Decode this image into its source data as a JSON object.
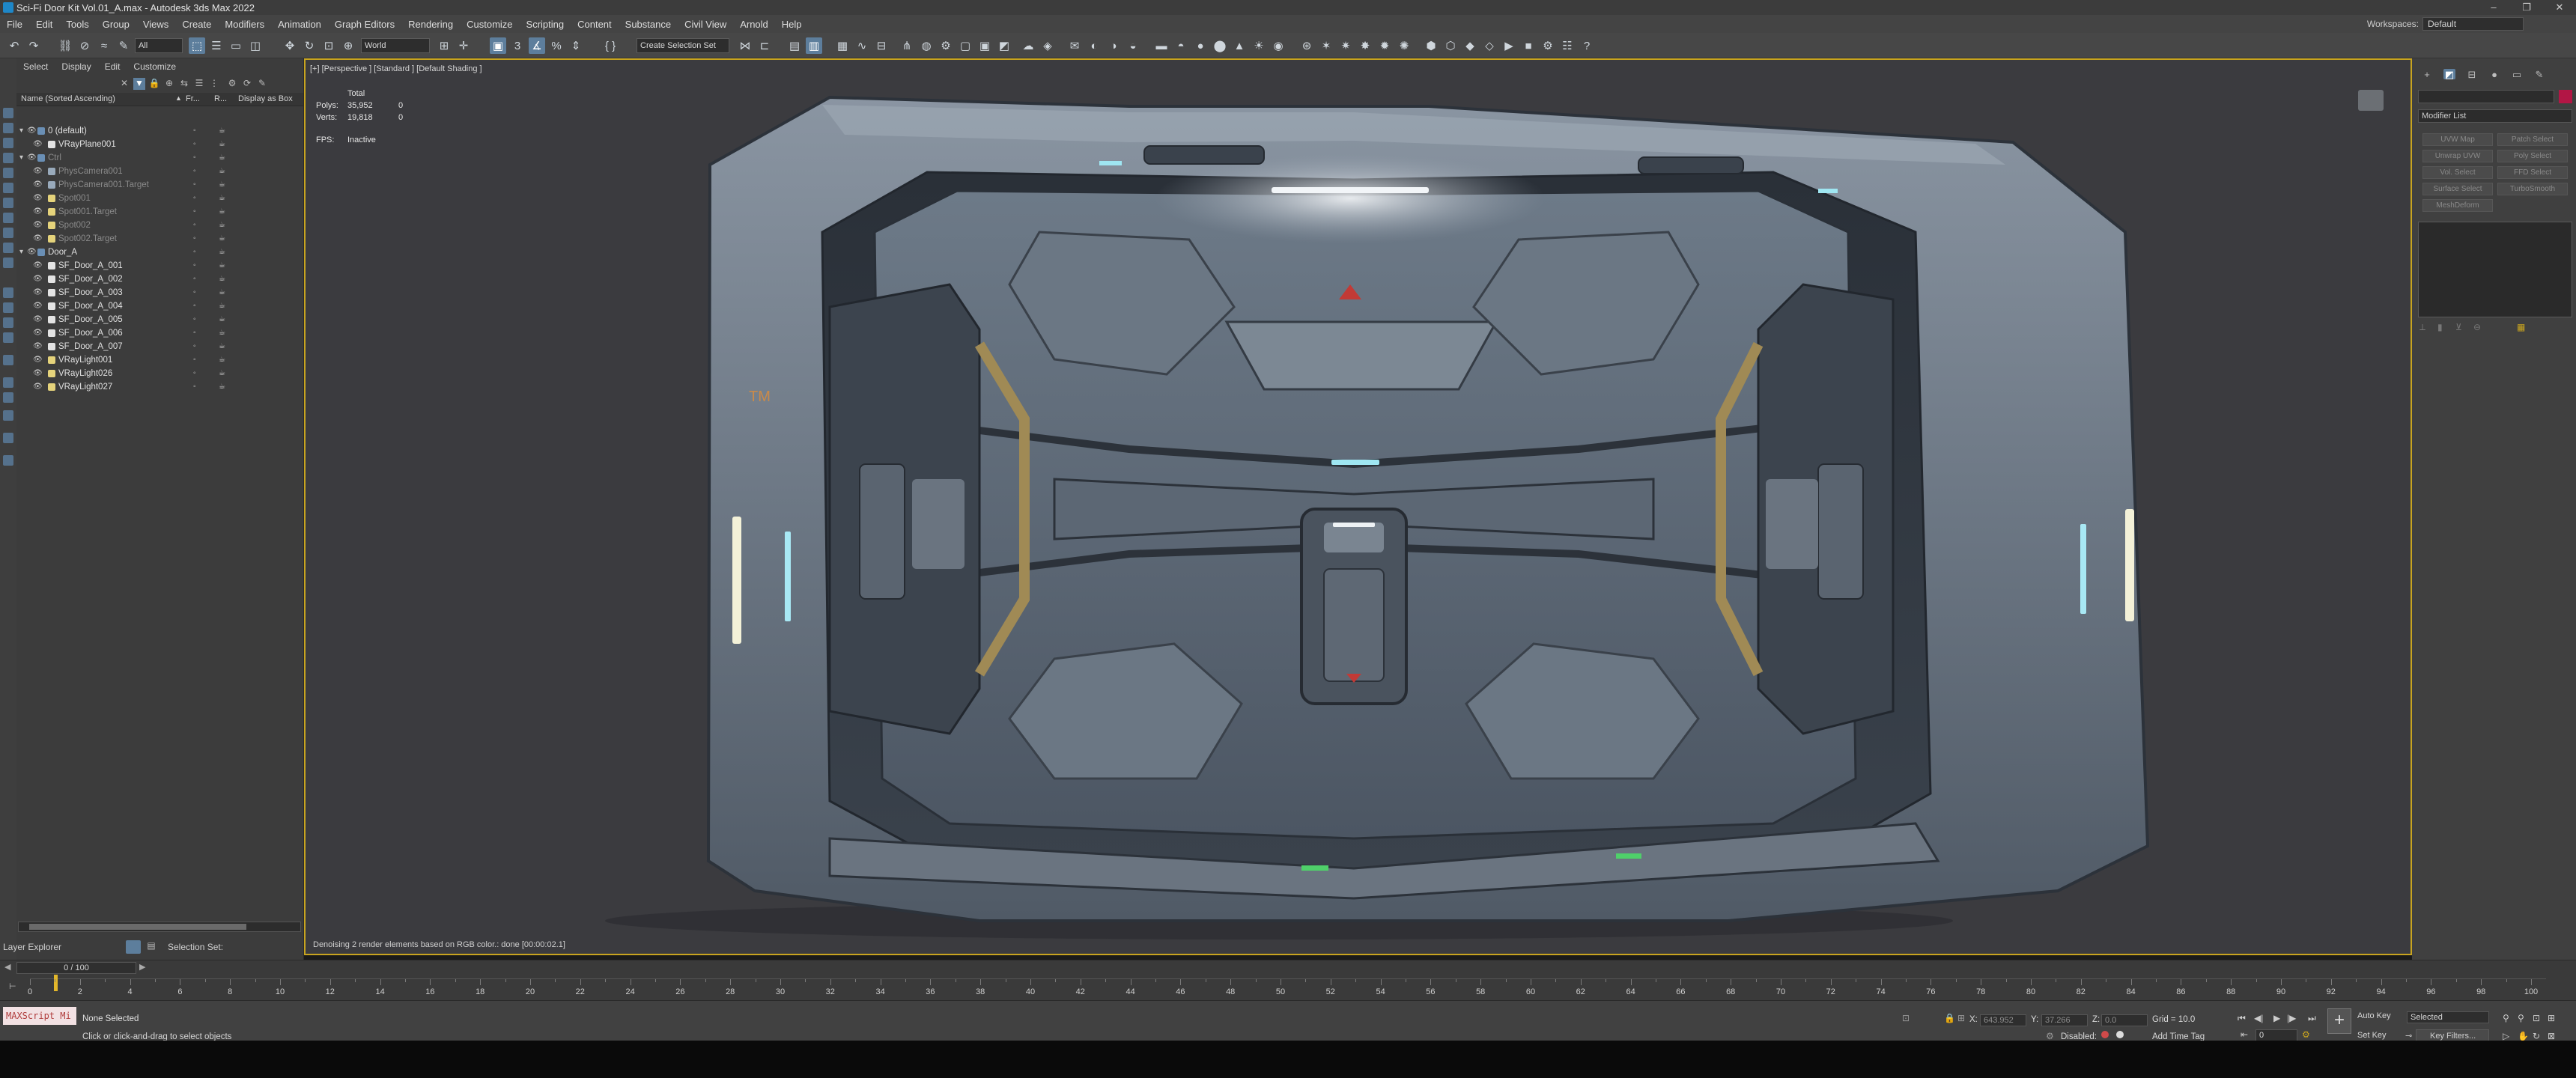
{
  "window": {
    "title": "Sci-Fi Door Kit Vol.01_A.max - Autodesk 3ds Max 2022",
    "controls": [
      "–",
      "❐",
      "✕"
    ]
  },
  "menu": {
    "items": [
      "File",
      "Edit",
      "Tools",
      "Group",
      "Views",
      "Create",
      "Modifiers",
      "Animation",
      "Graph Editors",
      "Rendering",
      "Customize",
      "Scripting",
      "Content",
      "Substance",
      "Civil View",
      "Arnold",
      "Help"
    ],
    "workspace_label": "Workspaces:",
    "workspace_value": "Default"
  },
  "toolbar": {
    "selection_filter": "All",
    "ref_coord": "World",
    "named_selection": "Create Selection Set"
  },
  "scene_explorer": {
    "tabs": [
      "Select",
      "Display",
      "Edit",
      "Customize"
    ],
    "columns": [
      "Name (Sorted Ascending)",
      "Fr...",
      "R...",
      "Display as Box"
    ],
    "rows": [
      {
        "name": "0 (default)",
        "indent": 1,
        "type": "layer",
        "dim": false
      },
      {
        "name": "VRayPlane001",
        "indent": 2,
        "type": "geo",
        "dim": false
      },
      {
        "name": "Ctrl",
        "indent": 1,
        "type": "layer",
        "dim": true
      },
      {
        "name": "PhysCamera001",
        "indent": 2,
        "type": "cam",
        "dim": true
      },
      {
        "name": "PhysCamera001.Target",
        "indent": 2,
        "type": "cam",
        "dim": true
      },
      {
        "name": "Spot001",
        "indent": 2,
        "type": "light",
        "dim": true
      },
      {
        "name": "Spot001.Target",
        "indent": 2,
        "type": "light",
        "dim": true
      },
      {
        "name": "Spot002",
        "indent": 2,
        "type": "light",
        "dim": true
      },
      {
        "name": "Spot002.Target",
        "indent": 2,
        "type": "light",
        "dim": true
      },
      {
        "name": "Door_A",
        "indent": 1,
        "type": "layer",
        "dim": false
      },
      {
        "name": "SF_Door_A_001",
        "indent": 2,
        "type": "geo",
        "dim": false
      },
      {
        "name": "SF_Door_A_002",
        "indent": 2,
        "type": "geo",
        "dim": false
      },
      {
        "name": "SF_Door_A_003",
        "indent": 2,
        "type": "geo",
        "dim": false
      },
      {
        "name": "SF_Door_A_004",
        "indent": 2,
        "type": "geo",
        "dim": false
      },
      {
        "name": "SF_Door_A_005",
        "indent": 2,
        "type": "geo",
        "dim": false
      },
      {
        "name": "SF_Door_A_006",
        "indent": 2,
        "type": "geo",
        "dim": false
      },
      {
        "name": "SF_Door_A_007",
        "indent": 2,
        "type": "geo",
        "dim": false
      },
      {
        "name": "VRayLight001",
        "indent": 2,
        "type": "light",
        "dim": false
      },
      {
        "name": "VRayLight026",
        "indent": 2,
        "type": "light",
        "dim": false
      },
      {
        "name": "VRayLight027",
        "indent": 2,
        "type": "light",
        "dim": false
      }
    ],
    "bottom_label": "Layer Explorer",
    "selection_set_label": "Selection Set:"
  },
  "viewport": {
    "label": "[+] [Perspective ] [Standard ] [Default Shading ]",
    "stats_title": "Total",
    "polys_label": "Polys:",
    "polys_value": "35,952",
    "polys_sel": "0",
    "verts_label": "Verts:",
    "verts_value": "19,818",
    "verts_sel": "0",
    "fps_label": "FPS:",
    "fps_value": "Inactive",
    "render_status": "Denoising 2 render elements based on RGB color.: done [00:00:02.1]",
    "door_labels": {
      "tm": "TM"
    }
  },
  "command_panel": {
    "modifier_list": "Modifier List",
    "buttons": [
      "UVW Map",
      "Patch Select",
      "Unwrap UVW",
      "Poly Select",
      "Vol. Select",
      "FFD Select",
      "Surface Select",
      "TurboSmooth",
      "MeshDeform"
    ]
  },
  "timeline": {
    "frame": "0 / 100",
    "ticks": [
      "0",
      "2",
      "4",
      "6",
      "8",
      "10",
      "12",
      "14",
      "16",
      "18",
      "20",
      "22",
      "24",
      "26",
      "28",
      "30",
      "32",
      "34",
      "36",
      "38",
      "40",
      "42",
      "44",
      "46",
      "48",
      "50",
      "52",
      "54",
      "56",
      "58",
      "60",
      "62",
      "64",
      "66",
      "68",
      "70",
      "72",
      "74",
      "76",
      "78",
      "80",
      "82",
      "84",
      "86",
      "88",
      "90",
      "92",
      "94",
      "96",
      "98",
      "100"
    ]
  },
  "statusbar": {
    "maxscript": "MAXScript Mi",
    "selection": "None Selected",
    "hint": "Click or click-and-drag to select objects",
    "x_label": "X:",
    "x_value": "643.952",
    "y_label": "Y:",
    "y_value": "37.266",
    "z_label": "Z:",
    "z_value": "0.0",
    "grid": "Grid = 10.0",
    "disabled_label": "Disabled:",
    "add_time_tag": "Add Time Tag",
    "auto_key": "Auto Key",
    "set_key": "Set Key",
    "key_mode": "Selected",
    "key_filters": "Key Filters...",
    "frame_value": "0"
  },
  "colors": {
    "accent": "#c8a41f",
    "active_btn": "#5d7e9c",
    "object_color": "#b21645",
    "panel": "#3c3c3c"
  }
}
